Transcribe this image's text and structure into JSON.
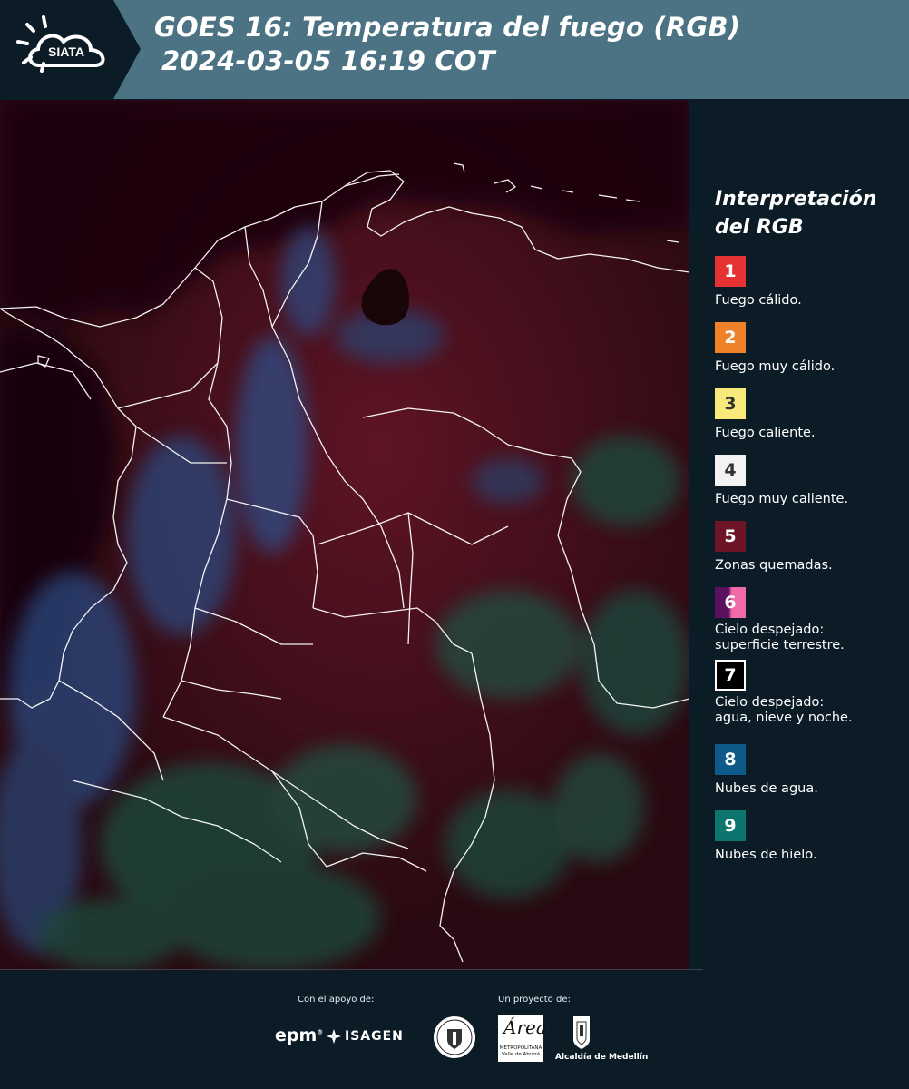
{
  "header": {
    "brand": "SIATA",
    "title_line1": "GOES 16: Temperatura del fuego (RGB)",
    "title_line2": "2024-03-05 16:19 COT",
    "background_color": "#4b7384",
    "logo_background_color": "#0c1c26"
  },
  "map": {
    "description_icon": "satellite-fire-temperature-map"
  },
  "legend": {
    "title_line1": "Interpretación",
    "title_line2": "del RGB",
    "items": [
      {
        "number": "1",
        "label": "Fuego cálido.",
        "color": "#e63232",
        "text_color": "#ffffff"
      },
      {
        "number": "2",
        "label": "Fuego muy cálido.",
        "color": "#ef8228",
        "text_color": "#ffffff"
      },
      {
        "number": "3",
        "label": "Fuego caliente.",
        "color": "#f8ea7a",
        "text_color": "#333333"
      },
      {
        "number": "4",
        "label": "Fuego muy caliente.",
        "color": "#f3f3f3",
        "text_color": "#333333"
      },
      {
        "number": "5",
        "label": "Zonas quemadas.",
        "color": "#6d1526",
        "text_color": "#ffffff"
      },
      {
        "number": "6",
        "label_line1": "Cielo despejado:",
        "label_line2": "superficie terrestre.",
        "color": "#5a1260",
        "color2": "#f06aa8",
        "text_color": "#ffffff"
      },
      {
        "number": "7",
        "label_line1": "Cielo despejado:",
        "label_line2": "agua, nieve y noche.",
        "color": "#000000",
        "text_color": "#ffffff"
      },
      {
        "number": "8",
        "label": "Nubes de agua.",
        "color": "#0e5a8a",
        "text_color": "#ffffff"
      },
      {
        "number": "9",
        "label": "Nubes de hielo.",
        "color": "#0c766e",
        "text_color": "#ffffff"
      }
    ]
  },
  "footer": {
    "support_label": "Con el apoyo de:",
    "project_label": "Un proyecto de:",
    "epm": "epm",
    "isagen": "ISAGEN",
    "area_script": "Área",
    "area_small_line1": "METROPOLITANA",
    "area_small_line2": "Valle de Aburrá",
    "medellin": "Alcaldía de Medellín"
  }
}
